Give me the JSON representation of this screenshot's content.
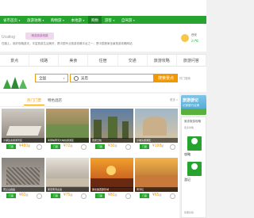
{
  "nav": {
    "items": [
      {
        "label": "省市首页",
        "active": false
      },
      {
        "label": "旅游攻略",
        "active": false
      },
      {
        "label": "购物游",
        "active": false
      },
      {
        "label": "本地游",
        "active": false
      },
      {
        "label": "购物",
        "active": true
      },
      {
        "label": "游客",
        "active": false
      },
      {
        "label": "自驾游",
        "active": false
      }
    ]
  },
  "header": {
    "logo_text": "Ucatlog",
    "badge_text": "精选旅游线路",
    "tagline": "在路上，用好攻略游天，丰富旅游生活美好，是中国专业旅游攻略平台之一，是中国首家全景旅游攻略网站",
    "weather_city": "西安",
    "weather_temp": "27℃"
  },
  "categories": [
    "景点",
    "线路",
    "美食",
    "住宿",
    "交通",
    "旅游攻略",
    "旅游问答"
  ],
  "search": {
    "city": "全国",
    "query": "吴忠",
    "button": "搜索景点",
    "right_text": "热门搜索"
  },
  "tabs": [
    "热门门票",
    "特色酒店"
  ],
  "more_label": "更多 >",
  "cards": [
    {
      "caption": "沙湖生态旅游景区",
      "badge": "门票",
      "price": "¥480",
      "unit": "起"
    },
    {
      "caption": "青铜峡黄河大峡谷旅游区",
      "badge": "门票",
      "price": "¥72",
      "unit": "起"
    },
    {
      "caption": "西夏王陵",
      "badge": "门票",
      "price": "¥30",
      "unit": "起"
    },
    {
      "caption": "沙坡头旅游区",
      "badge": "门票",
      "price": "¥198",
      "unit": "起"
    },
    {
      "caption": "贺兰山岩画",
      "badge": "门票",
      "price": "¥60",
      "unit": "起"
    },
    {
      "caption": "吴忠黄河古渡",
      "badge": "门票",
      "price": "¥75",
      "unit": "起"
    },
    {
      "caption": "镇北堡西部影城",
      "badge": "门票",
      "price": "¥80",
      "unit": "起"
    },
    {
      "caption": "黄河坛",
      "badge": "门票",
      "price": "¥65",
      "unit": "起"
    }
  ],
  "sidebar": {
    "ad_title": "旅游游记",
    "ad_sub": "记录旅行点滴",
    "panel_title": "吴忠旅游攻略",
    "panel_sub": "更多攻略",
    "btn1_label": "攻略",
    "btn2_label": "游记",
    "foot": "我要投稿"
  }
}
